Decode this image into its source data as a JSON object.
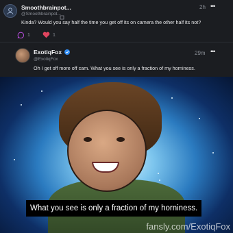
{
  "reply": {
    "author_name": "Smoothbrainpot...",
    "author_handle": "@Smoothbrainpot...",
    "time": "2h",
    "more_icon": "more-dots",
    "text": "Kinda? Would you say half the time you get off its on camera the other half its not?",
    "reply_count": "1",
    "like_count": "1",
    "like_color": "#e0455f"
  },
  "post": {
    "author_name": "ExotiqFox",
    "author_handle": "@ExotiqFox",
    "verified_icon": "verified-badge",
    "time": "29m",
    "more_icon": "more-dots",
    "text": "Oh I get off more off cam. What you see is only a fraction of my horniness."
  },
  "media": {
    "caption": "What you see is only a fraction of my horniness.",
    "watermark": "fansly.com/ExotiqFox"
  },
  "colors": {
    "background": "#16181c",
    "accent": "#2f8cf5"
  }
}
